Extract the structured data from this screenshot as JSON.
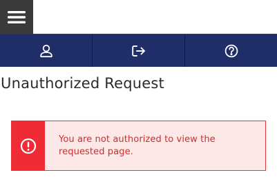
{
  "header": {
    "menu_icon": "hamburger-menu-icon"
  },
  "nav": {
    "items": [
      {
        "icon": "user-icon"
      },
      {
        "icon": "logout-icon"
      },
      {
        "icon": "help-icon"
      }
    ]
  },
  "page": {
    "title": "Unauthorized Request"
  },
  "alert": {
    "icon": "exclamation-circle-icon",
    "message": "You are not authorized to view the requested page.",
    "colors": {
      "border": "#e8333b",
      "background": "#fde8e8",
      "icon_background": "#ef2b35",
      "text": "#d42a2a"
    }
  },
  "colors": {
    "navbar": "#1f2d69",
    "menu_button": "#3a3a3a"
  }
}
